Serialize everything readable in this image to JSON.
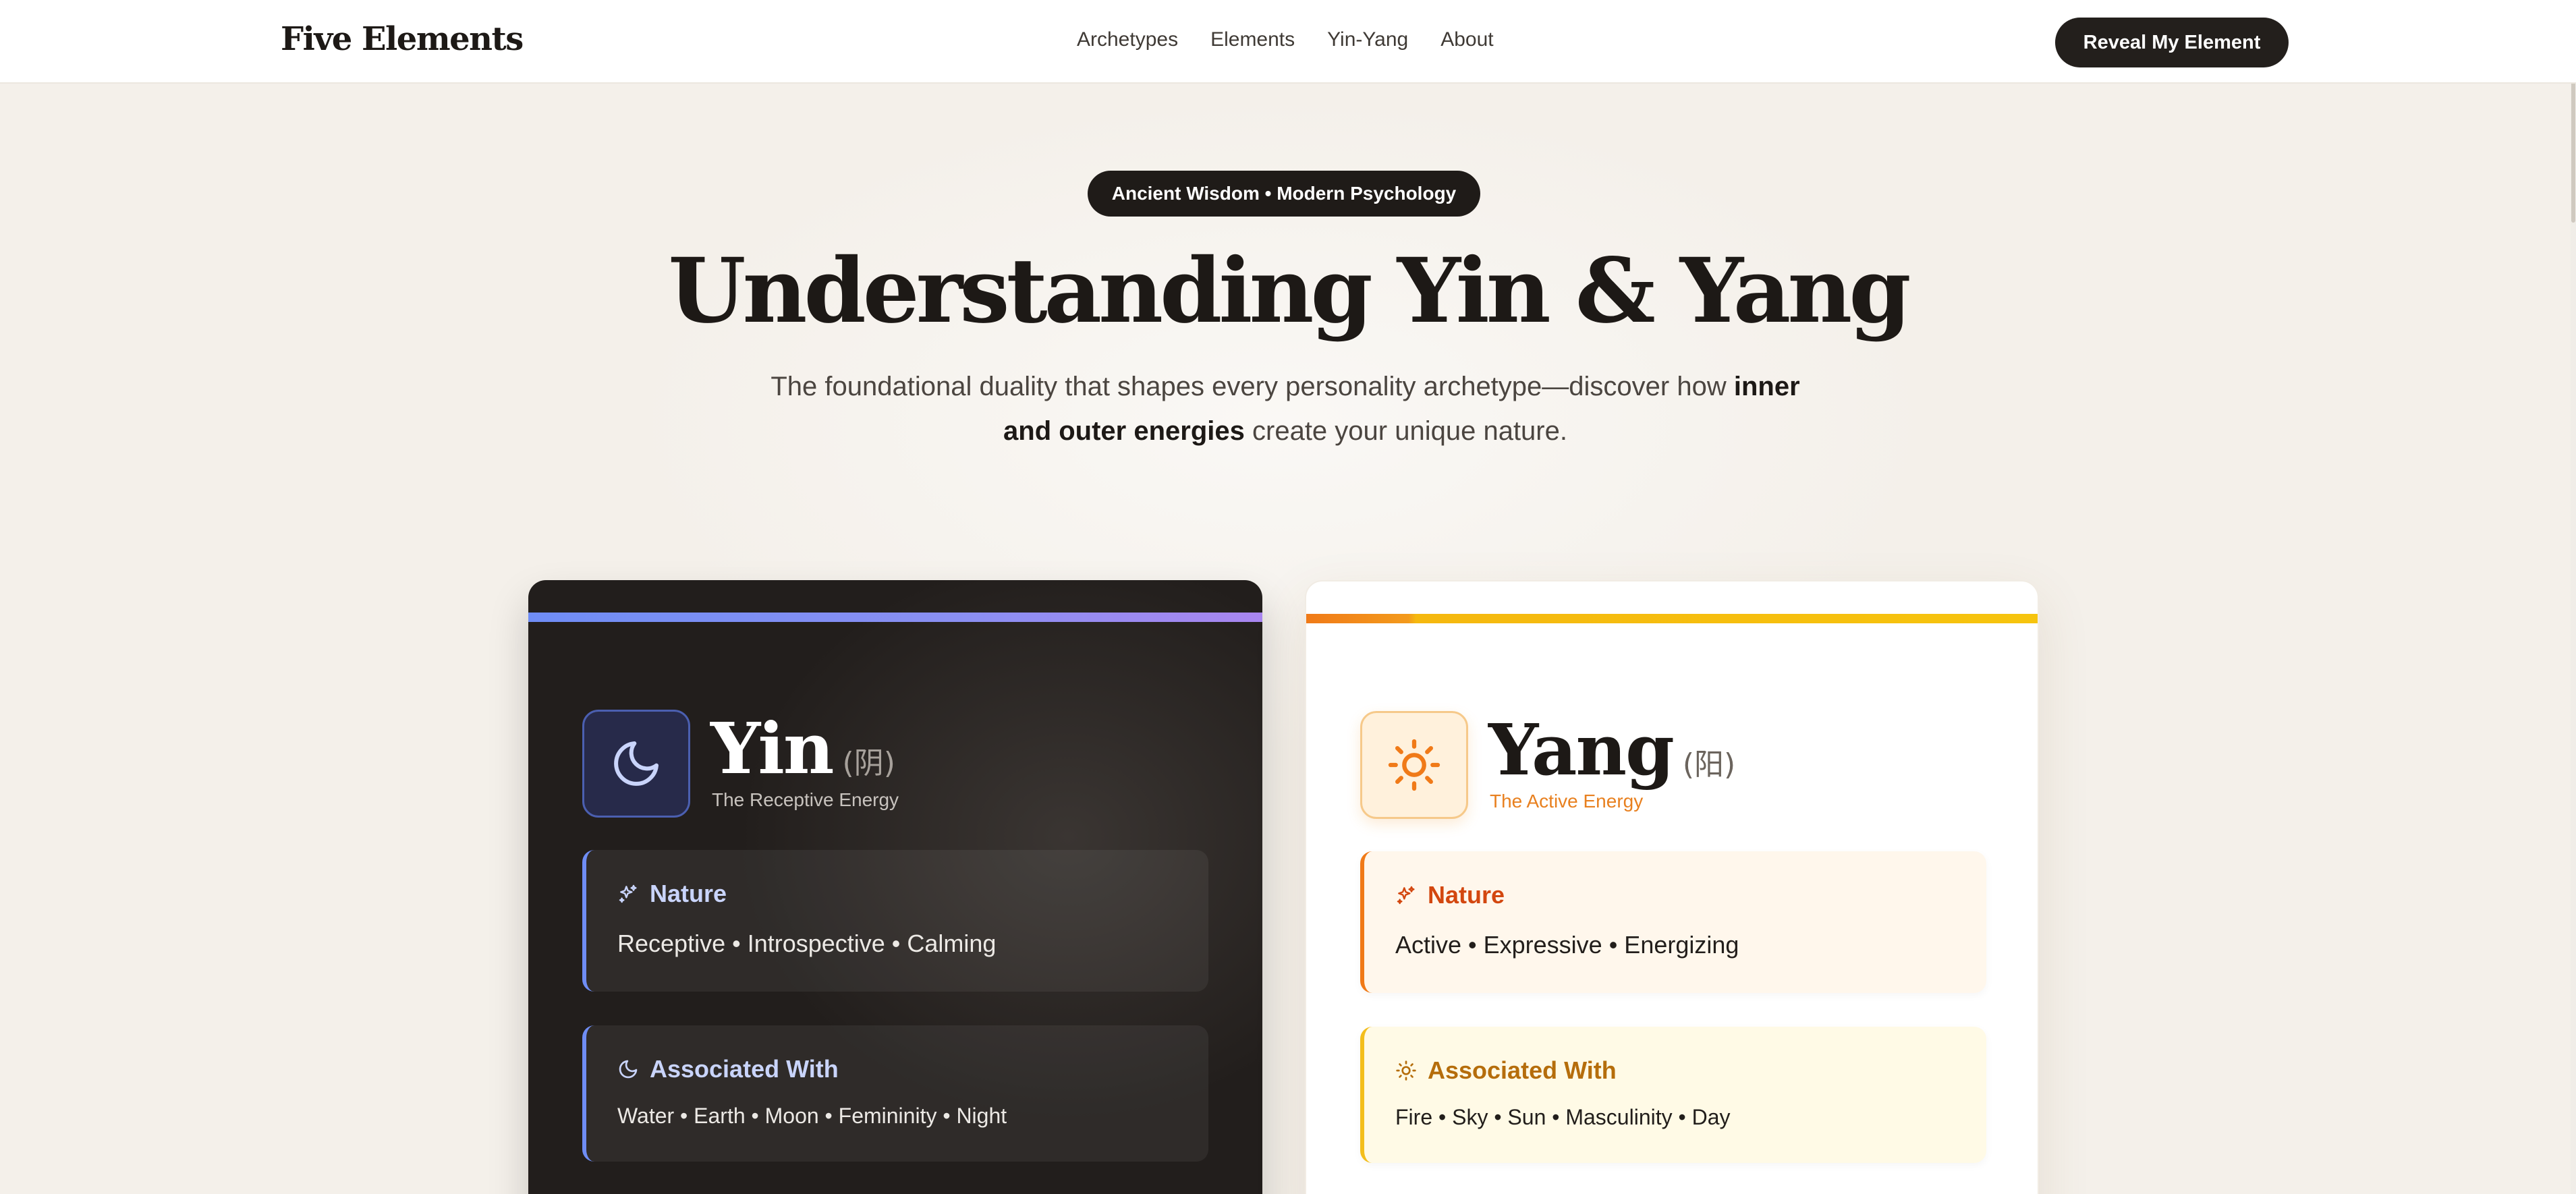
{
  "header": {
    "brand": "Five Elements",
    "nav": [
      "Archetypes",
      "Elements",
      "Yin-Yang",
      "About"
    ],
    "cta": "Reveal My Element"
  },
  "hero": {
    "badge": "Ancient Wisdom • Modern Psychology",
    "title": "Understanding Yin & Yang",
    "subtitle_pre": "The foundational duality that shapes every personality archetype—discover how ",
    "subtitle_bold": "inner and outer energies",
    "subtitle_post": " create your unique nature."
  },
  "yin": {
    "name": "Yin",
    "chinese": "(阴)",
    "tagline": "The Receptive Energy",
    "emblem_icon": "moon-icon",
    "nature_title": "Nature",
    "nature_text": "Receptive • Introspective • Calming",
    "assoc_title": "Associated With",
    "assoc_text": "Water • Earth • Moon • Femininity • Night",
    "accent": "#6f8df5"
  },
  "yang": {
    "name": "Yang",
    "chinese": "(阳)",
    "tagline": "The Active Energy",
    "emblem_icon": "sun-icon",
    "nature_title": "Nature",
    "nature_text": "Active • Expressive • Energizing",
    "assoc_title": "Associated With",
    "assoc_text": "Fire • Sky • Sun • Masculinity • Day",
    "accent": "#f07a18"
  }
}
